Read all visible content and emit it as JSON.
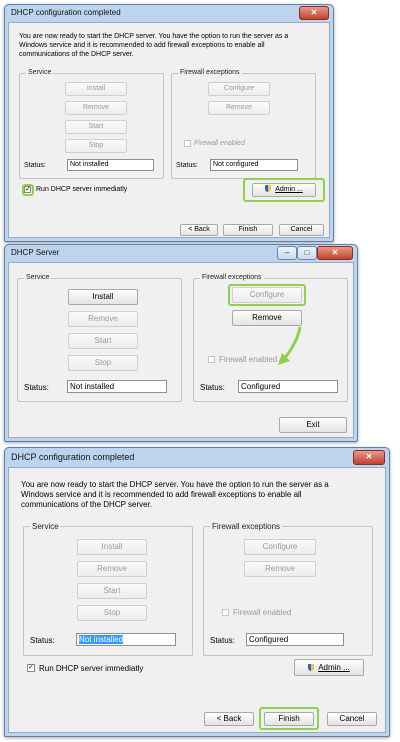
{
  "panels": [
    {
      "title": "DHCP configuration completed",
      "intro": "You are now ready to start the DHCP server. You have the option to run the server as a Windows service and it is recommended to add firewall exceptions to enable all communications of the DHCP server.",
      "service": {
        "label": "Service",
        "install": "Install",
        "remove": "Remove",
        "start": "Start",
        "stop": "Stop",
        "status_label": "Status:",
        "status": "Not installed"
      },
      "firewall": {
        "label": "Firewall exceptions",
        "configure": "Configure",
        "remove": "Remove",
        "enabled_label": "Firewall enabled",
        "status_label": "Status:",
        "status": "Not configured"
      },
      "run_label": "Run DHCP server immediatly",
      "admin": "Admin ...",
      "back": "< Back",
      "finish": "Finish",
      "cancel": "Cancel"
    },
    {
      "title": "DHCP Server",
      "service": {
        "label": "Service",
        "install": "Install",
        "remove": "Remove",
        "start": "Start",
        "stop": "Stop",
        "status_label": "Status:",
        "status": "Not installed"
      },
      "firewall": {
        "label": "Firewall exceptions",
        "configure": "Configure",
        "remove": "Remove",
        "enabled_label": "Firewall enabled",
        "status_label": "Status:",
        "status": "Configured"
      },
      "exit": "Exit"
    },
    {
      "title": "DHCP configuration completed",
      "intro": "You are now ready to start the DHCP server. You have the option to run the server as a Windows service and it is recommended to add firewall exceptions to enable all communications of the DHCP server.",
      "service": {
        "label": "Service",
        "install": "Install",
        "remove": "Remove",
        "start": "Start",
        "stop": "Stop",
        "status_label": "Status:",
        "status": "Not installed"
      },
      "firewall": {
        "label": "Firewall exceptions",
        "configure": "Configure",
        "remove": "Remove",
        "enabled_label": "Firewall enabled",
        "status_label": "Status:",
        "status": "Configured"
      },
      "run_label": "Run DHCP server immediatly",
      "admin": "Admin ...",
      "back": "< Back",
      "finish": "Finish",
      "cancel": "Cancel"
    }
  ],
  "icons": {
    "close": "close-icon",
    "minimize": "minimize-icon",
    "maximize": "maximize-icon",
    "check": "check-icon",
    "shield": "shield-icon",
    "arrow": "arrow-icon"
  },
  "colors": {
    "highlight": "#8fd14f",
    "titlebar": "#bcd4ee",
    "selection": "#3399ff"
  }
}
